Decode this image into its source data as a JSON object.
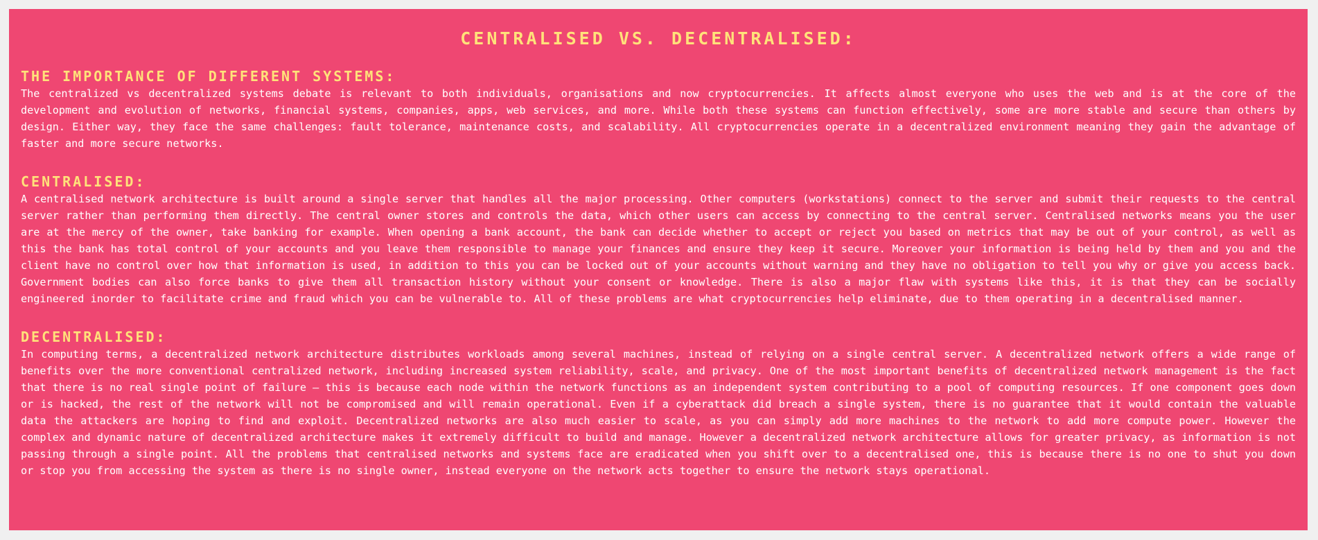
{
  "title": "CENTRALISED VS. DECENTRALISED:",
  "sections": [
    {
      "heading": "THE IMPORTANCE OF DIFFERENT SYSTEMS:",
      "body": "The centralized vs decentralized systems debate is relevant to both individuals, organisations and now cryptocurrencies. It affects almost everyone who uses the web and is at the core of the development and evolution of networks, financial systems, companies, apps, web services, and more. While both these systems can function effectively, some are more stable and secure than others by design. Either way, they face the same challenges: fault tolerance, maintenance costs, and scalability. All cryptocurrencies operate in a decentralized environment meaning they gain the advantage of faster and more secure networks."
    },
    {
      "heading": "CENTRALISED:",
      "body": "A centralised network architecture is built around a single server that handles all the major processing. Other computers (workstations) connect to the server and submit their requests to the central server rather than performing them directly. The central owner stores and controls the data, which other users can access by connecting to the central server. Centralised networks means you the user are at the mercy of the owner, take banking for example. When opening a bank account, the bank can decide whether to accept or reject you based on metrics that may be out of your control, as well as this the bank has total control of your accounts and you leave them responsible to manage your finances and ensure they keep it secure. Moreover your information is being held by them and you and the client have no control over how that information is used, in addition to this you can be locked out of your accounts without warning and they have no obligation to tell you why or give you access back. Government bodies can also force banks to give them all transaction history without your consent or knowledge. There is also a major flaw with systems like this, it is that they can be socially engineered inorder to facilitate crime and fraud which you can be vulnerable to. All of these problems are what cryptocurrencies help eliminate, due to them operating in a decentralised manner."
    },
    {
      "heading": "DECENTRALISED:",
      "body": "In computing terms, a decentralized network architecture distributes workloads among several machines, instead of relying on a single central server. A decentralized network offers a wide range of benefits over the more conventional centralized network, including increased system reliability, scale, and privacy. One of the most important benefits of decentralized network management is the fact that there is no real single point of failure — this is because each node within the network functions as an independent system contributing to a pool of computing resources. If one component goes down or is hacked, the rest of the network will not be compromised and will remain operational. Even if a cyberattack did breach a single system, there is no guarantee that it would contain the valuable data the attackers are hoping to find and exploit. Decentralized networks are also much easier to scale, as you can simply add more machines to the network to add more compute power. However the complex and dynamic nature of decentralized architecture makes it extremely difficult to build and manage. However a decentralized network architecture allows for greater privacy, as information is not passing through a single point. All the problems that centralised networks and systems face are eradicated when you shift over to a decentralised one, this is because there is no one to shut you down or stop you from accessing the system as there is no single owner, instead everyone on the network acts together to ensure the network stays operational."
    }
  ],
  "colors": {
    "panel_background": "#ef4772",
    "heading": "#ffe27a",
    "body_text": "#ffffff",
    "page_background": "#f0f0f0"
  }
}
